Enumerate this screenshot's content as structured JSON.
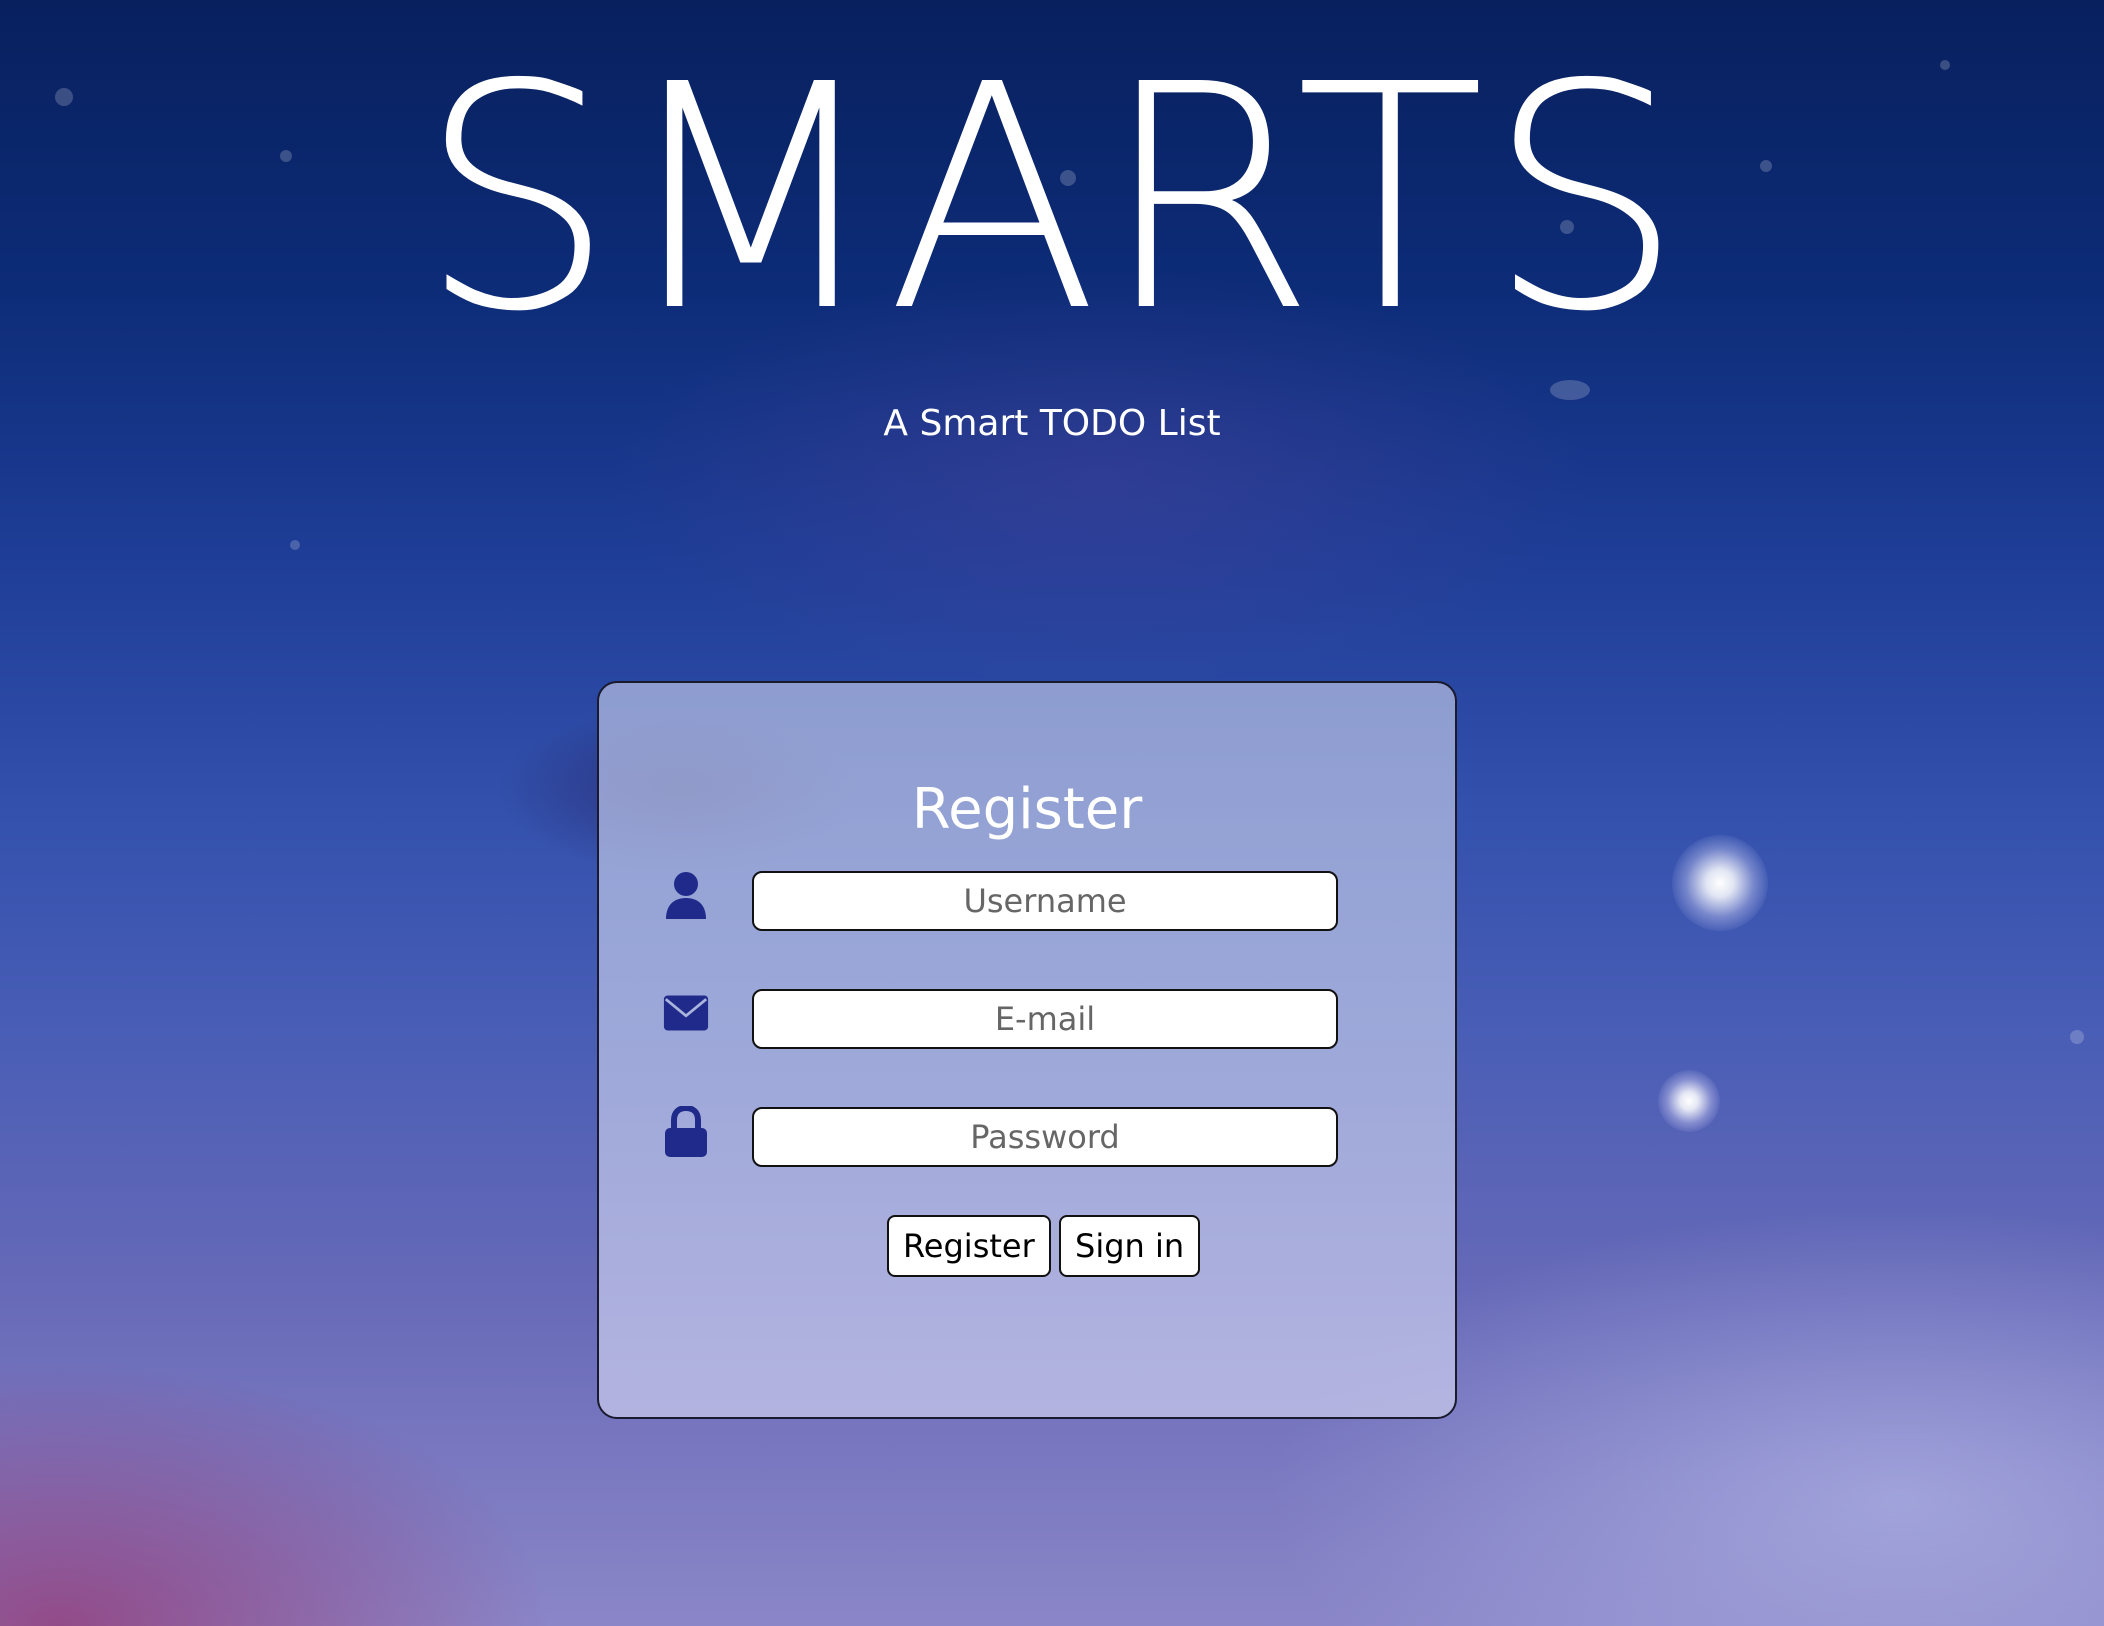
{
  "header": {
    "title": "SMARTS",
    "subtitle": "A Smart TODO List"
  },
  "form": {
    "title": "Register",
    "username": {
      "icon": "user-icon",
      "placeholder": "Username",
      "value": ""
    },
    "email": {
      "icon": "envelope-icon",
      "placeholder": "E-mail",
      "value": ""
    },
    "password": {
      "icon": "lock-icon",
      "placeholder": "Password",
      "value": ""
    },
    "register_label": "Register",
    "signin_label": "Sign in"
  },
  "colors": {
    "icon": "#1f2a8a",
    "title_text": "#ffffff",
    "button_border": "#111111"
  }
}
